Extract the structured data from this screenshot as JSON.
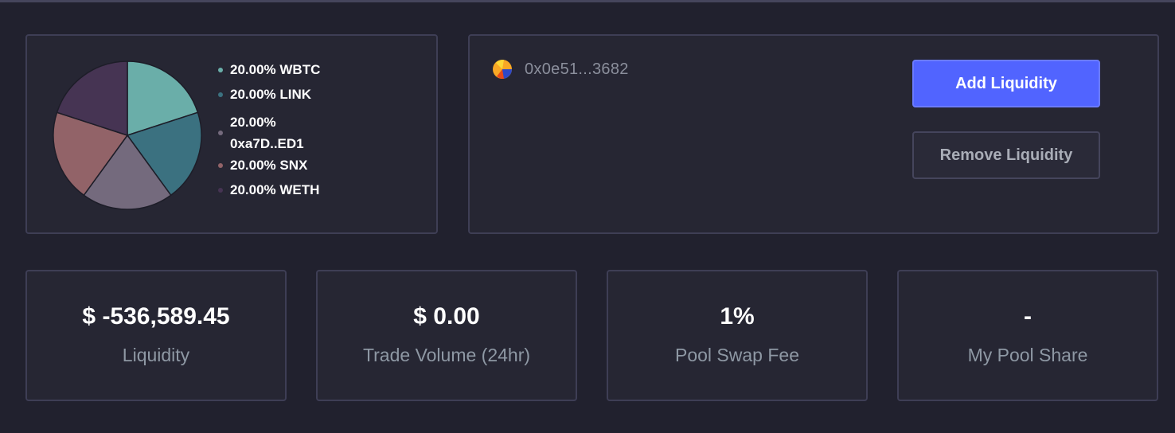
{
  "chart_data": {
    "type": "pie",
    "slices": [
      {
        "label": "20.00% WBTC",
        "value": 20.0,
        "color": "#6aaea9"
      },
      {
        "label": "20.00% LINK",
        "value": 20.0,
        "color": "#3b7180"
      },
      {
        "label": "20.00% 0xa7D..ED1",
        "value": 20.0,
        "color": "#746a7d"
      },
      {
        "label": "20.00% SNX",
        "value": 20.0,
        "color": "#926368"
      },
      {
        "label": "20.00% WETH",
        "value": 20.0,
        "color": "#463453"
      }
    ]
  },
  "legend": {
    "items": [
      {
        "label": "20.00% WBTC"
      },
      {
        "label": "20.00% LINK"
      },
      {
        "label": "20.00% 0xa7D..ED1"
      },
      {
        "label": "20.00% SNX"
      },
      {
        "label": "20.00% WETH"
      }
    ]
  },
  "pool": {
    "address": "0x0e51...3682",
    "add_label": "Add Liquidity",
    "remove_label": "Remove Liquidity"
  },
  "stats": [
    {
      "value": "$ -536,589.45",
      "label": "Liquidity"
    },
    {
      "value": "$ 0.00",
      "label": "Trade Volume (24hr)"
    },
    {
      "value": "1%",
      "label": "Pool Swap Fee"
    },
    {
      "value": "-",
      "label": "My Pool Share"
    }
  ],
  "colors": {
    "background": "#21212e",
    "panel": "#262633",
    "border": "#3e3e55",
    "accent": "#5164ff"
  },
  "icons": {
    "avatar": "pool-avatar-icon"
  }
}
